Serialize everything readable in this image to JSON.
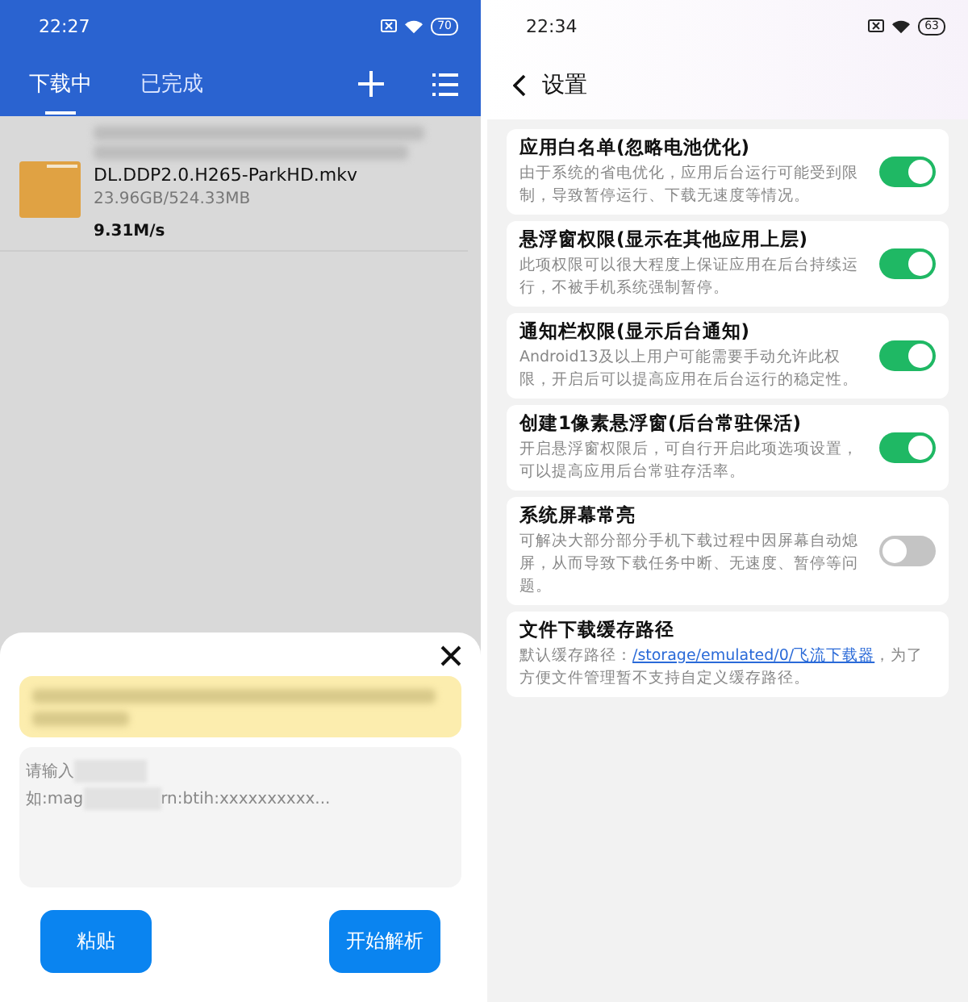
{
  "left": {
    "status_bar": {
      "time": "22:27",
      "battery": "70"
    },
    "tabs": [
      {
        "label": "下载中",
        "selected": true
      },
      {
        "label": "已完成",
        "selected": false
      }
    ],
    "download": {
      "name": "DL.DDP2.0.H265-ParkHD.mkv",
      "size": "23.96GB/524.33MB",
      "speed": "9.31M/s"
    },
    "sheet": {
      "placeholder_line_1": "请输入",
      "placeholder_line_2_start": "如:mag",
      "placeholder_line_2_end": "rn:btih:xxxxxxxxxx...",
      "buttons": [
        "粘贴",
        "开始解析"
      ]
    }
  },
  "right": {
    "status_bar": {
      "time": "22:34",
      "battery": "63"
    },
    "title": "设置",
    "settings": [
      {
        "kind": "toggle",
        "title": "应用白名单(忽略电池优化)",
        "description": "由于系统的省电优化，应用后台运行可能受到限制，导致暂停运行、下载无速度等情况。",
        "on": true
      },
      {
        "kind": "toggle",
        "title": "悬浮窗权限(显示在其他应用上层)",
        "description": "此项权限可以很大程度上保证应用在后台持续运行，不被手机系统强制暂停。",
        "on": true
      },
      {
        "kind": "toggle",
        "title": "通知栏权限(显示后台通知)",
        "description": "Android13及以上用户可能需要手动允许此权限，开启后可以提高应用在后台运行的稳定性。",
        "on": true
      },
      {
        "kind": "toggle",
        "title": "创建1像素悬浮窗(后台常驻保活)",
        "description": "开启悬浮窗权限后，可自行开启此项选项设置，可以提高应用后台常驻存活率。",
        "on": true
      },
      {
        "kind": "toggle",
        "title": "系统屏幕常亮",
        "description": "可解决大部分部分手机下载过程中因屏幕自动熄屏，从而导致下载任务中断、无速度、暂停等问题。",
        "on": false
      },
      {
        "kind": "path",
        "title": "文件下载缓存路径",
        "description": "默认缓存路径：",
        "link": "/storage/emulated/0/飞流下载器",
        "description_end": "，为了方便文件管理暂不支持自定义缓存路径。"
      }
    ]
  }
}
